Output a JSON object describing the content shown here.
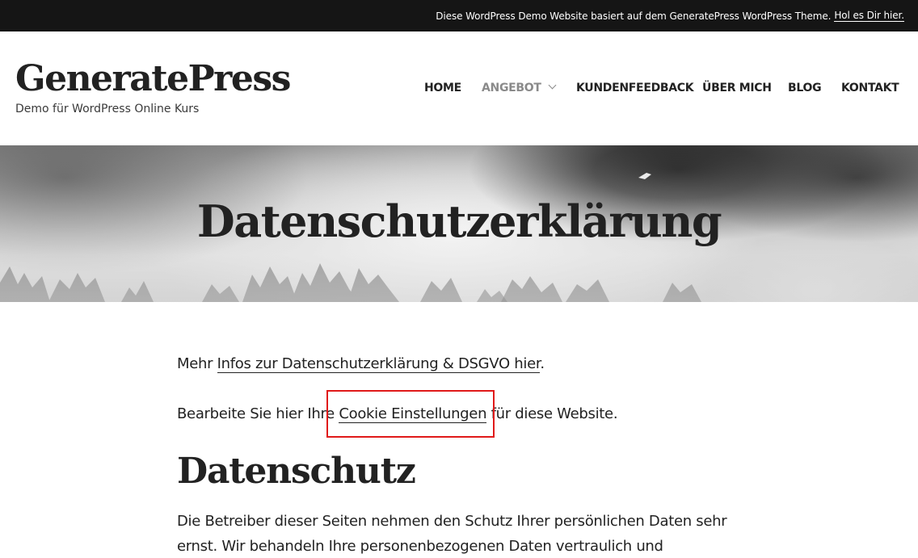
{
  "topbar": {
    "text": "Diese WordPress Demo Website basiert auf dem GeneratePress WordPress Theme.",
    "link_label": "Hol es Dir hier."
  },
  "header": {
    "site_title": "GeneratePress",
    "site_description": "Demo für WordPress Online Kurs"
  },
  "nav": {
    "items": [
      {
        "label": "HOME"
      },
      {
        "label": "ANGEBOT",
        "active": true,
        "has_dropdown": true
      },
      {
        "label": "KUNDENFEEDBACK"
      },
      {
        "label": "ÜBER MICH"
      },
      {
        "label": "BLOG"
      },
      {
        "label": "KONTAKT"
      }
    ]
  },
  "hero": {
    "title": "Datenschutzerklärung"
  },
  "content": {
    "p1_prefix": "Mehr ",
    "p1_link": "Infos zur Datenschutzerklärung & DSGVO hier",
    "p1_suffix": ".",
    "p2_prefix": "Bearbeite Sie hier Ihre ",
    "p2_link": "Cookie Einstellungen",
    "p2_suffix": " für diese Website.",
    "heading": "Datenschutz",
    "p3": "Die Betreiber dieser Seiten nehmen den Schutz Ihrer persönlichen Daten sehr ernst. Wir behandeln Ihre personenbezogenen Daten vertraulich und"
  },
  "colors": {
    "topbar_bg": "#151515",
    "text": "#222222",
    "nav_active": "#8a8a8a",
    "highlight": "#e01a1a"
  }
}
